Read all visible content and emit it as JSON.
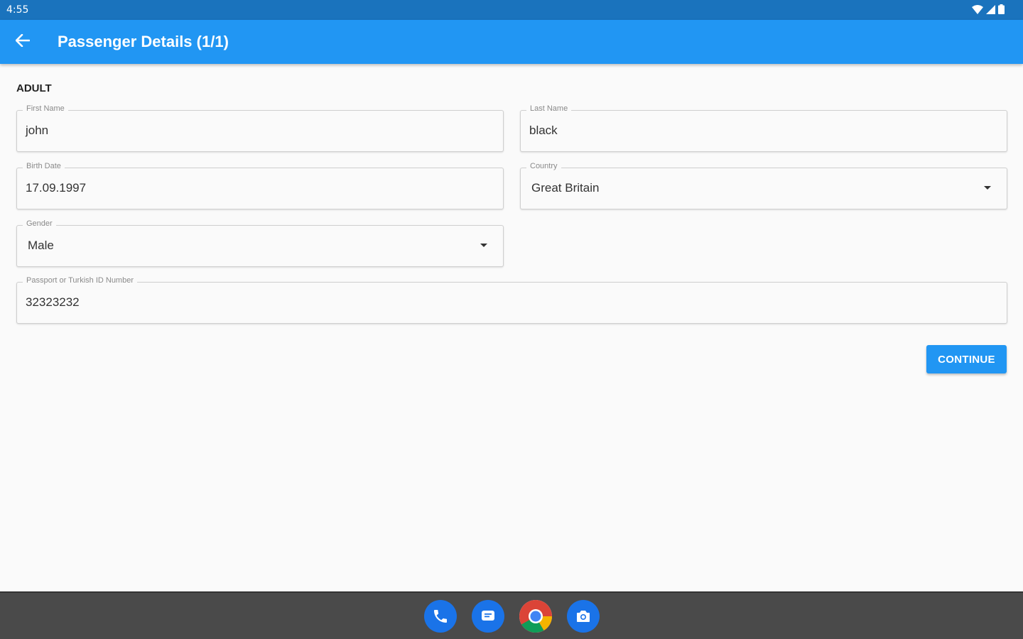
{
  "status_bar": {
    "time": "4:55"
  },
  "app_bar": {
    "title": "Passenger Details (1/1)",
    "back_icon": "arrow-back-icon"
  },
  "form": {
    "section_title": "ADULT",
    "first_name": {
      "label": "First Name",
      "value": "john"
    },
    "last_name": {
      "label": "Last Name",
      "value": "black"
    },
    "birth_date": {
      "label": "Birth Date",
      "value": "17.09.1997"
    },
    "country": {
      "label": "Country",
      "value": "Great Britain"
    },
    "gender": {
      "label": "Gender",
      "value": "Male"
    },
    "passport": {
      "label": "Passport or Turkish ID Number",
      "value": "32323232"
    },
    "continue_label": "CONTINUE"
  },
  "dock": {
    "apps": [
      "phone-icon",
      "messages-icon",
      "chrome-icon",
      "camera-icon"
    ]
  },
  "colors": {
    "status_bar": "#1a73bd",
    "app_bar": "#2196f3",
    "button": "#2196f3",
    "nav_bar": "#4a4a4a",
    "background": "#fafafa"
  }
}
